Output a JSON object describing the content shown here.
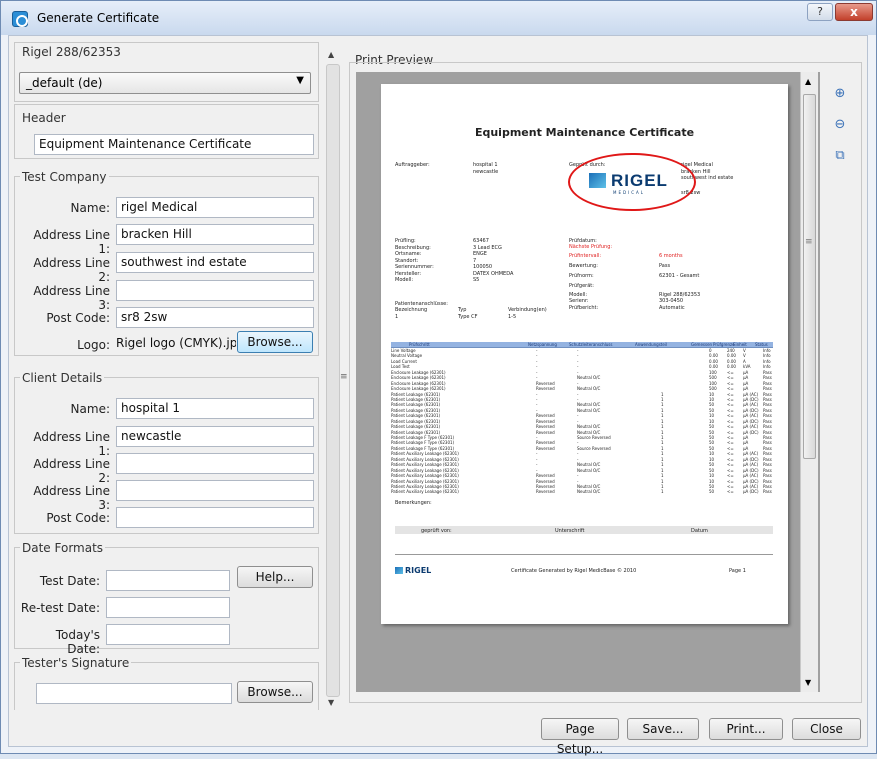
{
  "window": {
    "title": "Generate Certificate",
    "help_glyph": "?",
    "close_glyph": "x"
  },
  "left": {
    "device": "Rigel 288/62353",
    "language": "_default (de)",
    "header_group": "Header",
    "header_value": "Equipment Maintenance Certificate",
    "test_company": {
      "group": "Test Company",
      "name_label": "Name:",
      "name": "rigel Medical",
      "addr1_label": "Address Line 1:",
      "addr1": "bracken Hill",
      "addr2_label": "Address Line 2:",
      "addr2": "southwest ind estate",
      "addr3_label": "Address Line 3:",
      "addr3": "",
      "post_label": "Post Code:",
      "post": "sr8 2sw",
      "logo_label": "Logo:",
      "logo": "Rigel logo (CMYK).jpg",
      "browse": "Browse..."
    },
    "client": {
      "group": "Client Details",
      "name_label": "Name:",
      "name": "hospital 1",
      "addr1_label": "Address Line 1:",
      "addr1": "newcastle",
      "addr2_label": "Address Line 2:",
      "addr2": "",
      "addr3_label": "Address Line 3:",
      "addr3": "",
      "post_label": "Post Code:",
      "post": ""
    },
    "dates": {
      "group": "Date Formats",
      "test_label": "Test Date:",
      "retest_label": "Re-test Date:",
      "today_label": "Today's Date:",
      "help": "Help..."
    },
    "signature": {
      "group": "Tester's Signature",
      "browse": "Browse..."
    }
  },
  "preview": {
    "label": "Print Preview",
    "cert": {
      "title": "Equipment Maintenance Certificate",
      "auftraggeber_label": "Auftraggeber:",
      "auftraggeber": [
        "hospital 1",
        "newcastle"
      ],
      "geprueft_label": "Geprüft durch:",
      "geprueft": [
        "rigel Medical",
        "bracken Hill",
        "southwest ind estate",
        "sr8 2sw"
      ],
      "logo_text": "RIGEL",
      "logo_sub": "MEDICAL",
      "left_fields": [
        [
          "Prüfling:",
          "63467"
        ],
        [
          "Beschreibung:",
          "3 Lead ECG"
        ],
        [
          "Ortsname:",
          "ENGE"
        ],
        [
          "Standort:",
          "7"
        ],
        [
          "Seriennummer:",
          "100050"
        ],
        [
          "Hersteller:",
          "DATEX OHMEDA"
        ],
        [
          "Modell:",
          "S5"
        ]
      ],
      "right_fields": [
        [
          "Prüfdatum:",
          ""
        ],
        [
          "Nächste Prüfung:",
          ""
        ],
        [
          "Prüfintervall:",
          "6 months"
        ],
        [
          "Bewertung:",
          "Pass"
        ],
        [
          "Prüfnorm:",
          "62301 - Gesamt"
        ],
        [
          "Prüfgerät:",
          ""
        ],
        [
          "Modell:",
          "Rigel 288/62353"
        ],
        [
          "Serienr:",
          "303-0450"
        ],
        [
          "Prüfbericht:",
          "Automatic"
        ]
      ],
      "patient_label": "Patientenanschlüsse:",
      "patient_cols": [
        "Bezeichnung",
        "Typ",
        "Verbindung(en)"
      ],
      "patient_row": [
        "1",
        "Type CF",
        "1-5"
      ],
      "table_headers": [
        "Prüfschritt",
        "Netzspannung",
        "Schutzleiteranschluss",
        "Anwendungsteil",
        "Gemessen",
        "Prüfgrenze",
        "Einheit",
        "Status"
      ],
      "table_rows": [
        [
          "Line Voltage",
          "-",
          "-",
          "",
          "0",
          "240",
          "V",
          "Info"
        ],
        [
          "Neutral Voltage",
          "-",
          "-",
          "",
          "0.00",
          "0.00",
          "V",
          "Info"
        ],
        [
          "Load Current",
          "-",
          "-",
          "",
          "0.00",
          "0.00",
          "A",
          "Info"
        ],
        [
          "Load Test",
          "-",
          "-",
          "",
          "0.00",
          "0.00",
          "kVA",
          "Info"
        ],
        [
          "Enclosure Leakage (62301)",
          "-",
          "-",
          "",
          "100",
          "<=",
          "µA",
          "Pass"
        ],
        [
          "Enclosure Leakage (62301)",
          "-",
          "Neutral O/C",
          "",
          "500",
          "<=",
          "µA",
          "Pass"
        ],
        [
          "Enclosure Leakage (62301)",
          "Reversed",
          "-",
          "",
          "100",
          "<=",
          "µA",
          "Pass"
        ],
        [
          "Enclosure Leakage (62301)",
          "Reversed",
          "Neutral O/C",
          "",
          "500",
          "<=",
          "µA",
          "Pass"
        ],
        [
          "Patient Leakage (62301)",
          "-",
          "-",
          "1",
          "10",
          "<=",
          "µA (AC)",
          "Pass"
        ],
        [
          "Patient Leakage (62301)",
          "-",
          "-",
          "1",
          "10",
          "<=",
          "µA (DC)",
          "Pass"
        ],
        [
          "Patient Leakage (62301)",
          "-",
          "Neutral O/C",
          "1",
          "50",
          "<=",
          "µA (AC)",
          "Pass"
        ],
        [
          "Patient Leakage (62301)",
          "-",
          "Neutral O/C",
          "1",
          "50",
          "<=",
          "µA (DC)",
          "Pass"
        ],
        [
          "Patient Leakage (62301)",
          "Reversed",
          "-",
          "1",
          "10",
          "<=",
          "µA (AC)",
          "Pass"
        ],
        [
          "Patient Leakage (62301)",
          "Reversed",
          "-",
          "1",
          "10",
          "<=",
          "µA (DC)",
          "Pass"
        ],
        [
          "Patient Leakage (62301)",
          "Reversed",
          "Neutral O/C",
          "1",
          "50",
          "<=",
          "µA (AC)",
          "Pass"
        ],
        [
          "Patient Leakage (62301)",
          "Reversed",
          "Neutral O/C",
          "1",
          "50",
          "<=",
          "µA (DC)",
          "Pass"
        ],
        [
          "Patient Leakage F Type (62301)",
          "-",
          "Source Reversed",
          "1",
          "50",
          "<=",
          "µA",
          "Pass"
        ],
        [
          "Patient Leakage F Type (62301)",
          "Reversed",
          "-",
          "1",
          "50",
          "<=",
          "µA",
          "Pass"
        ],
        [
          "Patient Leakage F Type (62301)",
          "Reversed",
          "Source Reversed",
          "1",
          "50",
          "<=",
          "µA",
          "Pass"
        ],
        [
          "Patient Auxiliary Leakage (62301)",
          "-",
          "-",
          "1",
          "10",
          "<=",
          "µA (AC)",
          "Pass"
        ],
        [
          "Patient Auxiliary Leakage (62301)",
          "-",
          "-",
          "1",
          "10",
          "<=",
          "µA (DC)",
          "Pass"
        ],
        [
          "Patient Auxiliary Leakage (62301)",
          "-",
          "Neutral O/C",
          "1",
          "50",
          "<=",
          "µA (AC)",
          "Pass"
        ],
        [
          "Patient Auxiliary Leakage (62301)",
          "-",
          "Neutral O/C",
          "1",
          "50",
          "<=",
          "µA (DC)",
          "Pass"
        ],
        [
          "Patient Auxiliary Leakage (62301)",
          "Reversed",
          "-",
          "1",
          "10",
          "<=",
          "µA (AC)",
          "Pass"
        ],
        [
          "Patient Auxiliary Leakage (62301)",
          "Reversed",
          "-",
          "1",
          "10",
          "<=",
          "µA (DC)",
          "Pass"
        ],
        [
          "Patient Auxiliary Leakage (62301)",
          "Reversed",
          "Neutral O/C",
          "1",
          "50",
          "<=",
          "µA (AC)",
          "Pass"
        ],
        [
          "Patient Auxiliary Leakage (62301)",
          "Reversed",
          "Neutral O/C",
          "1",
          "50",
          "<=",
          "µA (DC)",
          "Pass"
        ]
      ],
      "remarks_label": "Bemerkungen:",
      "sign_cols": [
        "geprüft von:",
        "Unterschrift",
        "Datum"
      ],
      "footer_text": "Certificate Generated by Rigel MedicBase © 2010",
      "footer_page": "Page 1"
    }
  },
  "buttons": {
    "page_setup": "Page Setup...",
    "save": "Save...",
    "print": "Print...",
    "close": "Close"
  }
}
